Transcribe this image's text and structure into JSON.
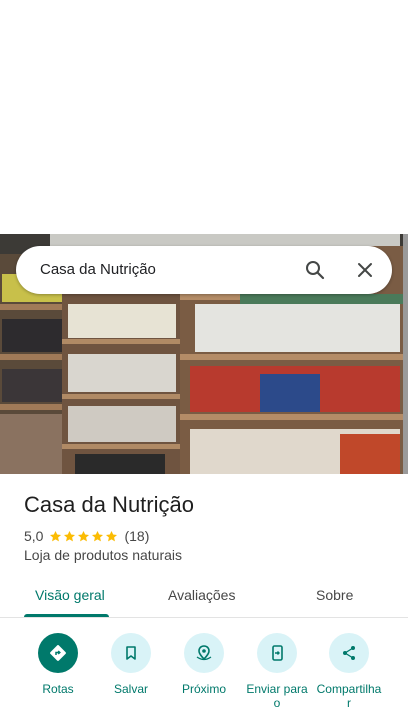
{
  "search": {
    "query": "Casa da Nutrição"
  },
  "place": {
    "name": "Casa da Nutrição",
    "rating": "5,0",
    "stars": 5,
    "review_count": "(18)",
    "category": "Loja de produtos naturais"
  },
  "tabs": [
    {
      "label": "Visão geral",
      "active": true
    },
    {
      "label": "Avaliações",
      "active": false
    },
    {
      "label": "Sobre",
      "active": false
    }
  ],
  "actions": [
    {
      "label": "Rotas",
      "icon": "directions-icon"
    },
    {
      "label": "Salvar",
      "icon": "bookmark-icon"
    },
    {
      "label": "Próximo",
      "icon": "nearby-icon"
    },
    {
      "label": "Enviar para",
      "label2": "o",
      "icon": "send-to-phone-icon"
    },
    {
      "label": "Compartilha",
      "label2": "r",
      "icon": "share-icon"
    }
  ],
  "colors": {
    "accent": "#00796b",
    "action_bg": "#d9f3f7",
    "star": "#fbbc04"
  }
}
